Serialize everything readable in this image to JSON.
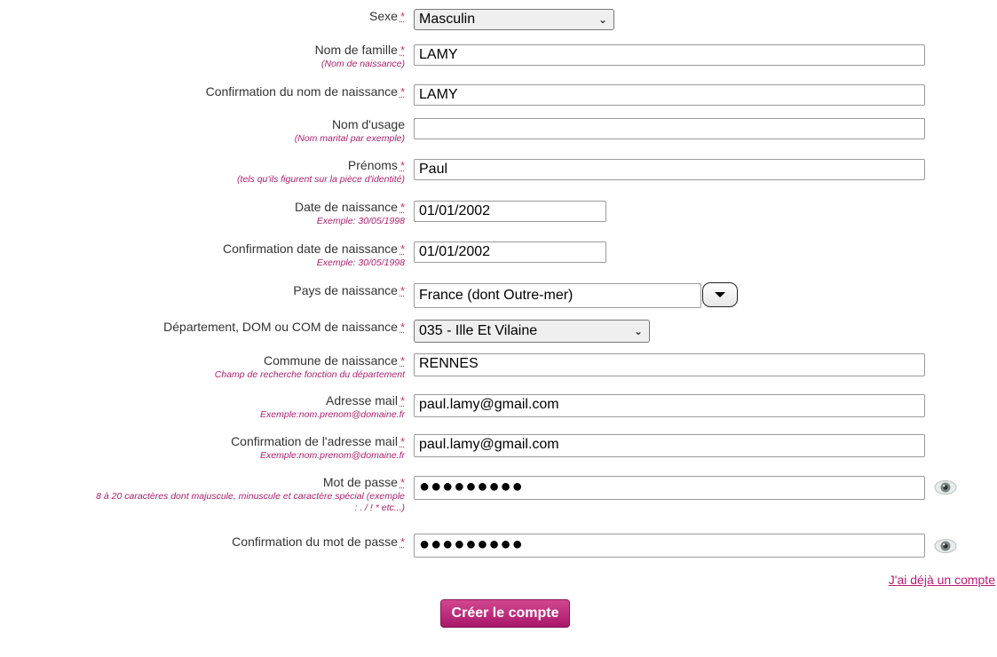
{
  "required_marker": "*",
  "fields": {
    "sexe": {
      "label": "Sexe",
      "value": "Masculin"
    },
    "nom_famille": {
      "label": "Nom de famille",
      "hint": "(Nom de naissance)",
      "value": "LAMY"
    },
    "confirm_nom": {
      "label": "Confirmation du nom de naissance",
      "value": "LAMY"
    },
    "nom_usage": {
      "label": "Nom d'usage",
      "hint": "(Nom marital par exemple)",
      "value": ""
    },
    "prenoms": {
      "label": "Prénoms",
      "hint": "(tels qu'ils figurent sur la pièce d'identité)",
      "value": "Paul"
    },
    "date_naissance": {
      "label": "Date de naissance",
      "hint": "Exemple: 30/05/1998",
      "value": "01/01/2002"
    },
    "confirm_date": {
      "label": "Confirmation date de naissance",
      "hint": "Exemple: 30/05/1998",
      "value": "01/01/2002"
    },
    "pays": {
      "label": "Pays de naissance",
      "value": "France (dont Outre-mer)"
    },
    "departement": {
      "label": "Département, DOM ou COM de naissance",
      "value": "035 - Ille Et Vilaine"
    },
    "commune": {
      "label": "Commune de naissance",
      "hint": "Champ de recherche fonction du département",
      "value": "RENNES"
    },
    "email": {
      "label": "Adresse mail",
      "hint": "Exemple:nom.prenom@domaine.fr",
      "value": "paul.lamy@gmail.com"
    },
    "confirm_email": {
      "label": "Confirmation de l'adresse mail",
      "hint": "Exemple:nom.prenom@domaine.fr",
      "value": "paul.lamy@gmail.com"
    },
    "password": {
      "label": "Mot de passe",
      "hint_line1": "8 à 20 caractères dont majuscule, minuscule et caractère spécial (exemple",
      "hint_line2": ": . / ! * etc...)",
      "value": "●●●●●●●●●"
    },
    "confirm_password": {
      "label": "Confirmation du mot de passe",
      "value": "●●●●●●●●●"
    }
  },
  "links": {
    "already_account": "J'ai déjà un compte"
  },
  "buttons": {
    "create_account": "Créer le compte"
  },
  "icons": {
    "eye": "eye-icon",
    "dropdown": "chevron-down-icon"
  },
  "colors": {
    "accent": "#c0186e",
    "hint": "#b01e6e",
    "button": "#b6237a"
  }
}
